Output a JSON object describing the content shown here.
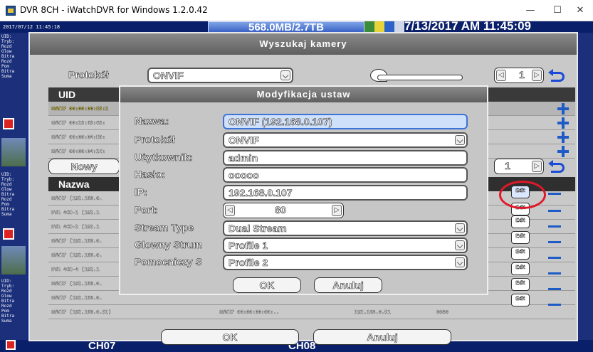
{
  "window": {
    "title": "DVR 8CH - iWatchDVR for Windows 1.2.0.42",
    "minimize": "—",
    "maximize": "☐",
    "close": "✕"
  },
  "dvr": {
    "timestamp_small": "2017/07/12 11:45:18",
    "storage": "568.0MB/2.7TB",
    "clock": "7/13/2017 AM 11:45:09",
    "left_info": "UID:\nTryb:\nRozd\nGlow\nBitra\nRozd\nPom\nBitra\nSuma",
    "channels": [
      "CH07",
      "CH08"
    ]
  },
  "search_dialog": {
    "title": "Wyszukaj kamery",
    "protocol_label": "Protokół",
    "protocol_value": "ONVIF",
    "page_value": "1",
    "uid_header": "UID",
    "uid_rows": [
      "ONVIF 00:00:00:E5:2",
      "ONVIF 00:23:63:63:",
      "ONVIF 00:00:04:E0:",
      "ONVIF 00:00:04:2C:"
    ],
    "new_button": "Nowy",
    "page_value_2": "1",
    "name_header": "Nazwa",
    "name_rows": [
      "ONVIF (192.168.0.",
      "DVR 4CH-1 (192.1",
      "DVR 4CH-2 (192.1",
      "ONVIF (192.168.0.",
      "ONVIF (192.168.0.",
      "DVR 4CH-4 (192.1",
      "ONVIF (192.168.0.",
      "ONVIF (192.168.0.",
      "ONVIF (192.168.0.51)"
    ],
    "last_row_cols": [
      "ONVIF 00:00:00:00:..",
      "192.168.0.51",
      "8080"
    ],
    "edit_label": "Edit",
    "ok_button": "OK",
    "cancel_button": "Anuluj"
  },
  "modify_dialog": {
    "title": "Modyfikacja ustaw",
    "fields": {
      "name_label": "Nazwa:",
      "name_value": "ONVIF (192.168.0.107)",
      "protocol_label": "Protokół",
      "protocol_value": "ONVIF",
      "user_label": "Użytkownik:",
      "user_value": "admin",
      "password_label": "Hasło:",
      "password_value": "ooooo",
      "ip_label": "IP:",
      "ip_value": "192.168.0.107",
      "port_label": "Port:",
      "port_value": "80",
      "stream_type_label": "Stream Type",
      "stream_type_value": "Dual Stream",
      "main_stream_label": "Glowny Strum",
      "main_stream_value": "Profile 1",
      "sub_stream_label": "Pomocniczy S",
      "sub_stream_value": "Profile 2"
    },
    "ok_button": "OK",
    "cancel_button": "Anuluj"
  },
  "colors": {
    "dvr_blue": "#0c2a8c",
    "highlight_red": "#e0182a",
    "icon_blue": "#1e5bc6"
  }
}
